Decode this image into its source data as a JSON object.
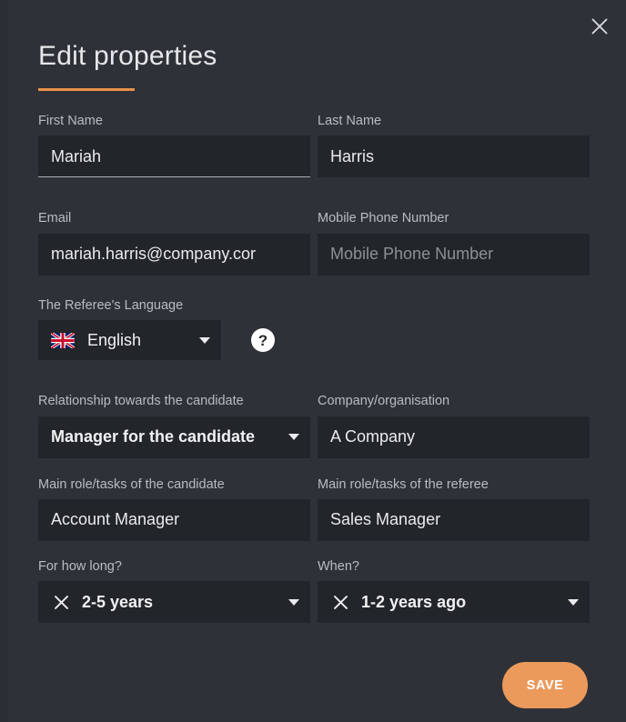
{
  "dialog": {
    "title": "Edit properties",
    "close_icon": "close-icon",
    "accent_color": "#e8924a",
    "background_color": "#2e3238",
    "field_background_color": "#222529"
  },
  "fields": {
    "first_name": {
      "label": "First Name",
      "value": "Mariah",
      "focused": true
    },
    "last_name": {
      "label": "Last Name",
      "value": "Harris",
      "focused": false
    },
    "email": {
      "label": "Email",
      "value": "mariah.harris@company.cor",
      "focused": false
    },
    "mobile_phone": {
      "label": "Mobile Phone Number",
      "value": "",
      "placeholder": "Mobile Phone Number",
      "focused": false
    },
    "language": {
      "label": "The Referee's Language",
      "value": "English",
      "flag_icon": "uk-flag-icon",
      "help_icon": "help-question-icon",
      "help_label": "?"
    },
    "relationship": {
      "label": "Relationship towards the candidate",
      "value": "Manager for the candidate"
    },
    "company": {
      "label": "Company/organisation",
      "value": "A Company"
    },
    "candidate_role": {
      "label": "Main role/tasks of the candidate",
      "value": "Account Manager"
    },
    "referee_role": {
      "label": "Main role/tasks of the referee",
      "value": "Sales Manager"
    },
    "duration": {
      "label": "For how long?",
      "value": "2-5 years",
      "clear_icon": "clear-x-icon"
    },
    "when": {
      "label": "When?",
      "value": "1-2 years ago",
      "clear_icon": "clear-x-icon"
    }
  },
  "footer": {
    "save_label": "SAVE",
    "save_color": "#eb9a5c"
  }
}
